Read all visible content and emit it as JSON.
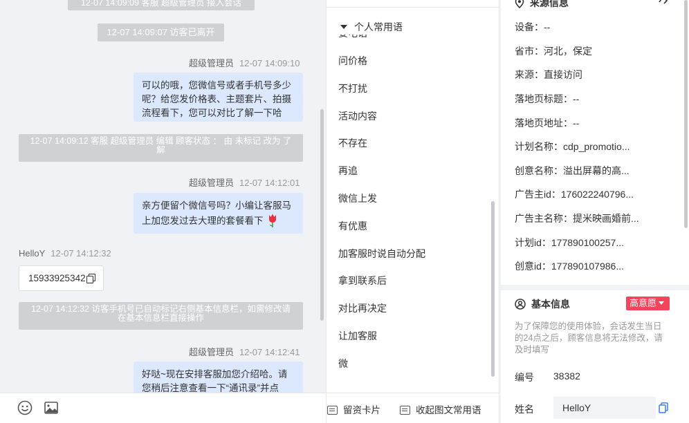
{
  "chat": {
    "top_system_note": "12-07 14:09:09 客服 超级管理员 接入会话",
    "visitor_left_note": "12-07 14:09:07 访客已离开",
    "messages": [
      {
        "sender": "超级管理员",
        "time": "12-07 14:09:10",
        "text": "可以的哦，您微信号或者手机号多少呢？给您发价格表、主题套片、拍摄流程看下，您可以对比了解一下哈"
      },
      {
        "sender": "超级管理员",
        "time": "12-07 14:12:01",
        "text": "亲方便留个微信号吗？小编让客服马上加您发过去大理的套餐看下"
      },
      {
        "sender": "HelloY",
        "time": "12-07 14:12:32",
        "text": "15933925342"
      },
      {
        "sender": "超级管理员",
        "time": "12-07 14:12:41",
        "text": "好哒~现在安排客服加您介绍哈。请您稍后注意查看一下“通讯录”并点"
      }
    ],
    "system_notes": [
      "12-07 14:09:12 客服 超级管理员 编辑 顾客状态 ： 由 未标记 改为 了解",
      "12-07 14:12:32 访客手机号已自动标记右侧基本信息栏，如需修改请在基本信息栏直接操作"
    ]
  },
  "phrases": {
    "cut_item": "要电话",
    "header": "个人常用语",
    "items": [
      "问价格",
      "不打扰",
      "活动内容",
      "不存在",
      "再追",
      "微信上发",
      "有优惠",
      "加客服时说自动分配",
      "拿到联系后",
      "对比再决定",
      "让加客服",
      "微"
    ],
    "actions": {
      "lead_card": "留资卡片",
      "collapse": "收起图文常用语"
    }
  },
  "info": {
    "source_title": "来源信息",
    "source_rows": [
      "设备：--",
      "省市：河北，保定",
      "来源：直接访问",
      "落地页标题：--",
      "落地页地址：--",
      "计划名称：cdp_promotio...",
      "创意名称：溢出屏幕的高...",
      "广告主id：176022240796...",
      "广告主名称：提米映画婚前...",
      "计划id：177890100257...",
      "创意id：177890107986..."
    ],
    "basic_title": "基本信息",
    "intent_badge": "高意愿",
    "notice": "为了保障您的使用体验，会话发生当日的24点之后，顾客信息将无法修改，请及时填写",
    "number_label": "编号",
    "number_value": "38382",
    "name_label": "姓名",
    "name_value": "HelloY"
  },
  "colors": {
    "bubble": "#dce8fe",
    "system_note": "#cfd1d4",
    "badge": "#f2445a"
  }
}
